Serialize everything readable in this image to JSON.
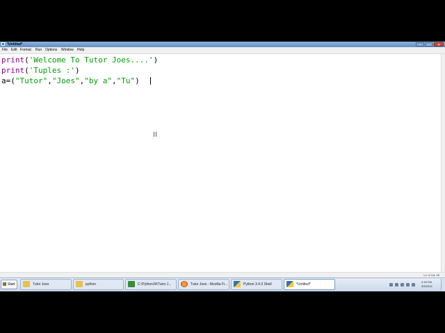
{
  "window": {
    "title": "*Untitled*"
  },
  "menu": [
    "File",
    "Edit",
    "Format",
    "Run",
    "Options",
    "Window",
    "Help"
  ],
  "code": {
    "line1": {
      "kw": "print",
      "open": "(",
      "str": "'Welcome To Tutor Joes....'",
      "close": ")"
    },
    "line2": {
      "kw": "print",
      "open": "(",
      "str": "'Tuples :'",
      "close": ")"
    },
    "line3": {
      "prefix": "a=(",
      "s1": "\"Tutor\"",
      "c1": ",",
      "s2": "\"Joes\"",
      "c2": ",",
      "s3": "\"by a\"",
      "c3": ",",
      "s4": "\"Tu\"",
      "close": ")"
    }
  },
  "status": {
    "position": "Ln: 3  Col: 25"
  },
  "taskbar": {
    "start_label": "Start",
    "tasks": [
      {
        "label": "Tutor Joes",
        "icon": "folder-icon"
      },
      {
        "label": "python",
        "icon": "folder-icon"
      },
      {
        "label": "C:\\Python34\\Tutor J...",
        "icon": "cmd-icon"
      },
      {
        "label": "Tutor Joes - Mozilla Fi...",
        "icon": "firefox-icon"
      },
      {
        "label": "Python 3.4.3 Shell",
        "icon": "python-icon"
      },
      {
        "label": "*Untitled*",
        "icon": "python-icon"
      }
    ]
  },
  "clock": {
    "time": "2:15 PM",
    "date": "3/9/2015"
  },
  "colors": {
    "keyword": "#900090",
    "string": "#00a000",
    "titlebar": "#6f9bd0",
    "taskbar": "#d6e2f0"
  }
}
